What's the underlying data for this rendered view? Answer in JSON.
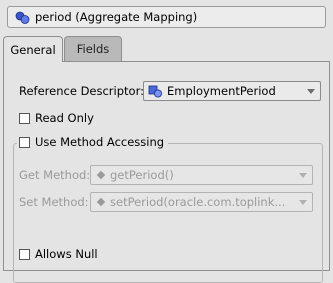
{
  "header": {
    "title": "period (Aggregate Mapping)",
    "icon": "aggregate-mapping-icon"
  },
  "tabs": [
    {
      "label": "General",
      "selected": true
    },
    {
      "label": "Fields",
      "selected": false
    }
  ],
  "general": {
    "reference_descriptor": {
      "label": "Reference Descriptor:",
      "value": "EmploymentPeriod",
      "icon": "descriptor-icon"
    },
    "read_only": {
      "label": "Read Only",
      "checked": false
    },
    "use_method_accessing": {
      "label": "Use Method Accessing",
      "checked": false,
      "get_method": {
        "label": "Get Method:",
        "value": "getPeriod()",
        "enabled": false
      },
      "set_method": {
        "label": "Set Method:",
        "value": "setPeriod(oracle.com.toplink...",
        "enabled": false
      }
    },
    "allows_null": {
      "label": "Allows Null",
      "checked": false
    }
  }
}
